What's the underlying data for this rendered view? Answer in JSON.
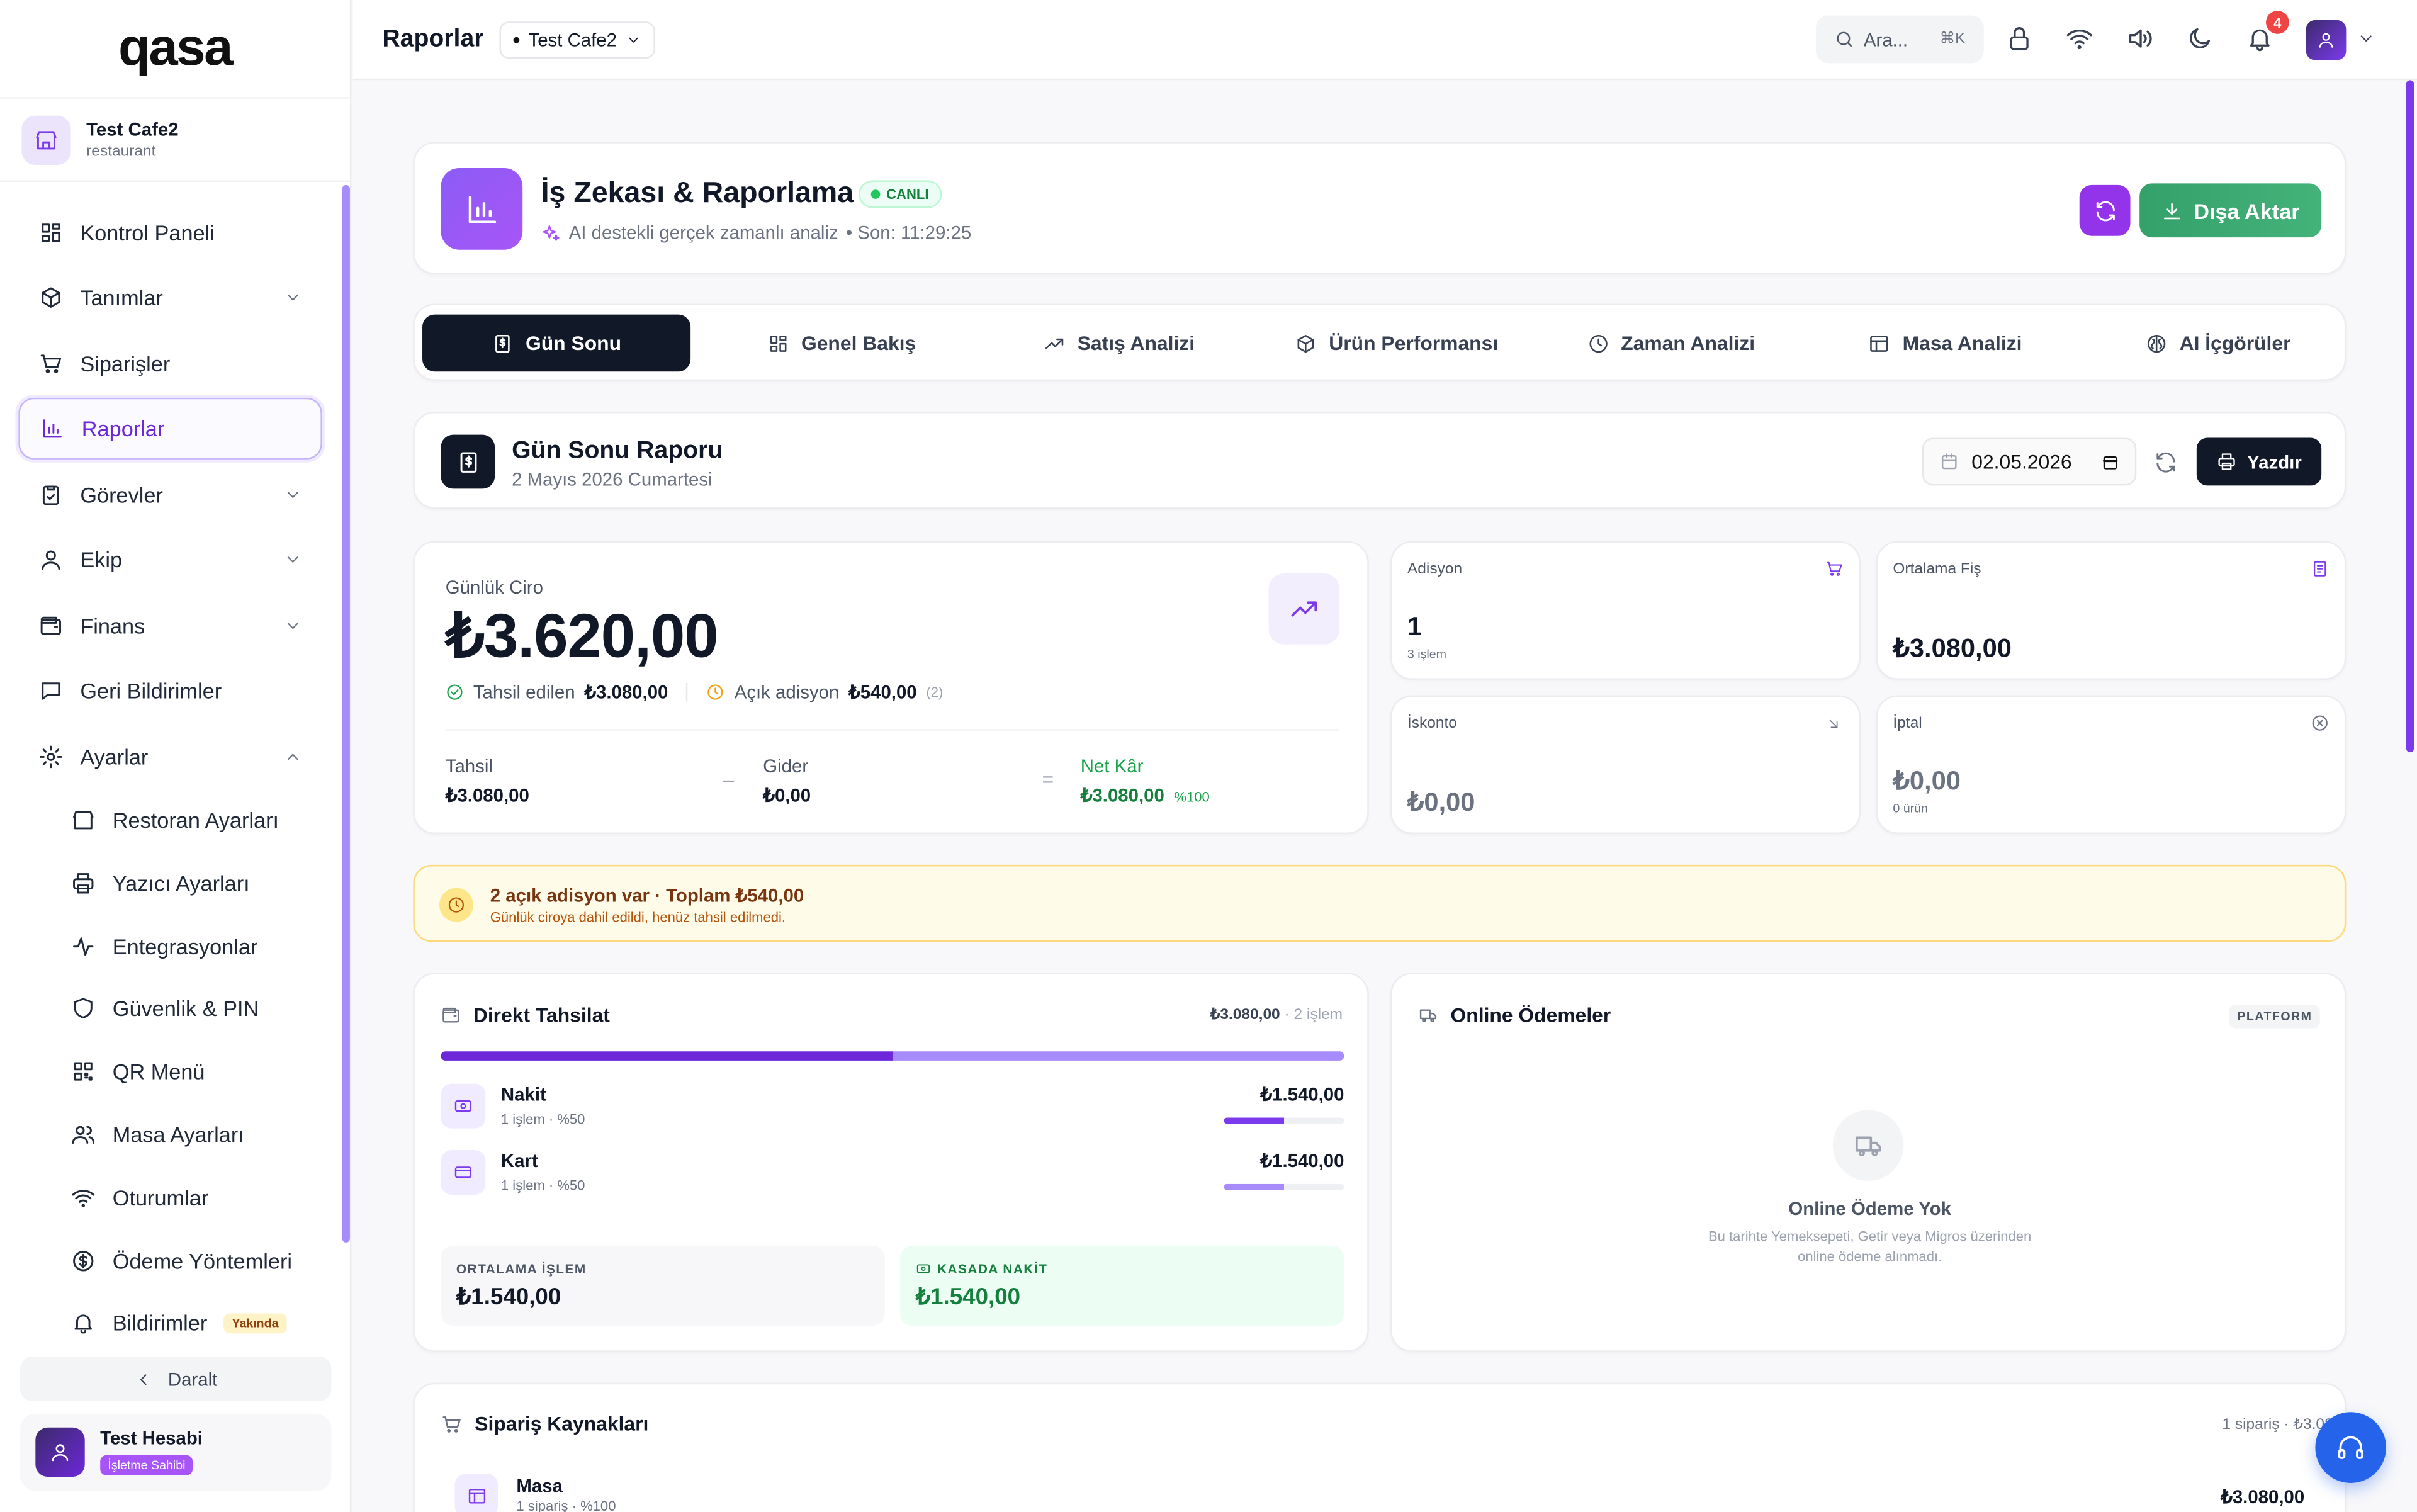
{
  "app": {
    "logo": "qasa"
  },
  "org": {
    "name": "Test Cafe2",
    "type": "restaurant"
  },
  "sidebar": {
    "items": [
      {
        "label": "Kontrol Paneli"
      },
      {
        "label": "Tanımlar"
      },
      {
        "label": "Siparişler"
      },
      {
        "label": "Raporlar"
      },
      {
        "label": "Görevler"
      },
      {
        "label": "Ekip"
      },
      {
        "label": "Finans"
      },
      {
        "label": "Geri Bildirimler"
      },
      {
        "label": "Ayarlar"
      }
    ],
    "sub_items": [
      {
        "label": "Restoran Ayarları"
      },
      {
        "label": "Yazıcı Ayarları"
      },
      {
        "label": "Entegrasyonlar"
      },
      {
        "label": "Güvenlik & PIN"
      },
      {
        "label": "QR Menü"
      },
      {
        "label": "Masa Ayarları"
      },
      {
        "label": "Oturumlar"
      },
      {
        "label": "Ödeme Yöntemleri"
      },
      {
        "label": "Bildirimler",
        "badge": "Yakında"
      }
    ],
    "collapse_label": "Daralt",
    "user": {
      "name": "Test Hesabi",
      "role": "İşletme Sahibi"
    }
  },
  "topbar": {
    "title": "Raporlar",
    "branch": "Test Cafe2",
    "search_placeholder": "Ara...",
    "search_shortcut": "⌘K",
    "notification_count": "4"
  },
  "hero": {
    "title": "İş Zekası & Raporlama",
    "live_badge": "CANLI",
    "subtitle": "AI destekli gerçek zamanlı analiz",
    "last_update": "• Son: 11:29:25",
    "export_label": "Dışa Aktar"
  },
  "tabs": [
    {
      "label": "Gün Sonu",
      "active": true
    },
    {
      "label": "Genel Bakış"
    },
    {
      "label": "Satış Analizi"
    },
    {
      "label": "Ürün Performansı"
    },
    {
      "label": "Zaman Analizi"
    },
    {
      "label": "Masa Analizi"
    },
    {
      "label": "AI İçgörüler"
    }
  ],
  "report": {
    "title": "Gün Sonu Raporu",
    "date_text": "2 Mayıs 2026 Cumartesi",
    "date_value": "02.05.2026",
    "print_label": "Yazdır"
  },
  "revenue": {
    "label": "Günlük Ciro",
    "value": "₺3.620,00",
    "collected_label": "Tahsil edilen",
    "collected_value": "₺3.080,00",
    "open_label": "Açık adisyon",
    "open_value": "₺540,00",
    "open_count": "(2)",
    "breakdown": {
      "collected_label": "Tahsil",
      "collected_value": "₺3.080,00",
      "minus": "–",
      "expense_label": "Gider",
      "expense_value": "₺0,00",
      "equals": "=",
      "profit_label": "Net Kâr",
      "profit_value": "₺3.080,00",
      "profit_pct": "%100"
    }
  },
  "stats": {
    "adisyon": {
      "label": "Adisyon",
      "value": "1",
      "sub": "3 işlem"
    },
    "avg_receipt": {
      "label": "Ortalama Fiş",
      "value": "₺3.080,00"
    },
    "discount": {
      "label": "İskonto",
      "value": "₺0,00"
    },
    "cancel": {
      "label": "İptal",
      "value": "₺0,00",
      "sub": "0 ürün"
    }
  },
  "alert": {
    "title": "2 açık adisyon var · Toplam ₺540,00",
    "subtitle": "Günlük ciroya dahil edildi, henüz tahsil edilmedi."
  },
  "direct": {
    "title": "Direkt Tahsilat",
    "total": "₺3.080,00",
    "count": "· 2 işlem",
    "cash_share": 0.5,
    "methods": [
      {
        "name": "Nakit",
        "sub": "1 işlem · %50",
        "value": "₺1.540,00",
        "share": 0.5
      },
      {
        "name": "Kart",
        "sub": "1 işlem · %50",
        "value": "₺1.540,00",
        "share": 0.5
      }
    ],
    "avg_label": "ORTALAMA İŞLEM",
    "avg_value": "₺1.540,00",
    "cash_label": "KASADA NAKİT",
    "cash_value": "₺1.540,00"
  },
  "online": {
    "title": "Online Ödemeler",
    "badge": "PLATFORM",
    "empty_title": "Online Ödeme Yok",
    "empty_text": "Bu tarihte Yemeksepeti, Getir veya Migros üzerinden online ödeme alınmadı."
  },
  "sources": {
    "title": "Sipariş Kaynakları",
    "summary": "1 sipariş · ₺3.080,00",
    "rows": [
      {
        "name": "Masa",
        "sub": "1 sipariş · %100",
        "value": "₺3.080,00"
      }
    ]
  },
  "colors": {
    "accent": "#7c3aed",
    "success": "#16a34a",
    "warning": "#b45309",
    "dark": "#111827"
  }
}
